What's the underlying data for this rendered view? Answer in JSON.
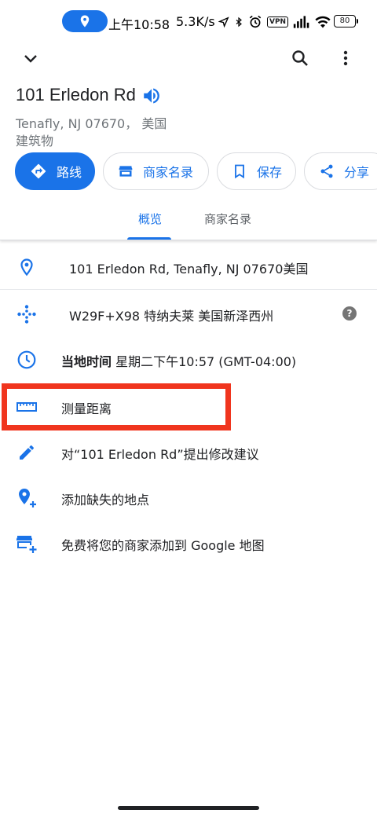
{
  "status_bar": {
    "time": "上午10:58",
    "speed": "5.3K/s",
    "vpn_label": "VPN",
    "battery": "80",
    "icons": [
      "location-icon",
      "navigation-icon",
      "bluetooth-icon",
      "alarm-icon",
      "signal-icon",
      "wifi-icon"
    ]
  },
  "app_bar": {
    "collapse_icon": "chevron-down-icon",
    "search_icon": "search-icon",
    "more_icon": "more-vert-icon"
  },
  "place": {
    "title": "101 Erledon Rd",
    "address_line": "Tenafly, NJ 07670， 美国",
    "category": "建筑物"
  },
  "actions": [
    {
      "label": "路线",
      "icon": "directions-icon"
    },
    {
      "label": "商家名录",
      "icon": "storefront-icon"
    },
    {
      "label": "保存",
      "icon": "bookmark-icon"
    },
    {
      "label": "分享",
      "icon": "share-icon"
    }
  ],
  "tabs": [
    {
      "label": "概览",
      "active": true
    },
    {
      "label": "商家名录",
      "active": false
    }
  ],
  "rows": {
    "address": "101 Erledon Rd, Tenafly, NJ 07670美国",
    "plus_code": "W29F+X98 特纳夫莱 美国新泽西州",
    "local_time_label": "当地时间",
    "local_time_value": " 星期二下午10:57 (GMT-04:00)",
    "measure": "测量距离",
    "suggest_edit": "对“101 Erledon Rd”提出修改建议",
    "add_place": "添加缺失的地点",
    "add_business": "免费将您的商家添加到 Google 地图"
  },
  "colors": {
    "accent": "#1a73e8",
    "highlight": "#f0351e",
    "secondary_text": "#70757a"
  }
}
